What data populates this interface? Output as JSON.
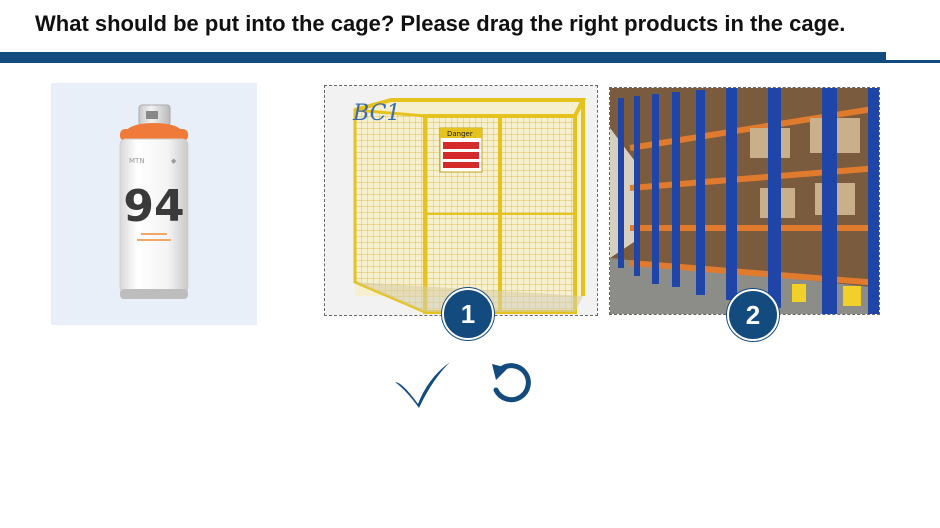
{
  "question": "What should be put into the cage? Please drag the right products in the cage.",
  "product": {
    "name_icon": "spray-can-icon",
    "label_number": "94",
    "cap_color": "#f07a3a"
  },
  "targets": [
    {
      "number": "1",
      "image_icon": "yellow-mesh-cage-icon",
      "signage": [
        "BC1",
        "Danger"
      ]
    },
    {
      "number": "2",
      "image_icon": "warehouse-racking-icon"
    }
  ],
  "actions": {
    "check_icon": "checkmark-icon",
    "reset_icon": "reset-arrow-icon"
  },
  "colors": {
    "accent": "#134b7f",
    "cage_yellow": "#e6c21f",
    "rack_blue": "#1f45a8",
    "rack_orange": "#e07a2c"
  }
}
